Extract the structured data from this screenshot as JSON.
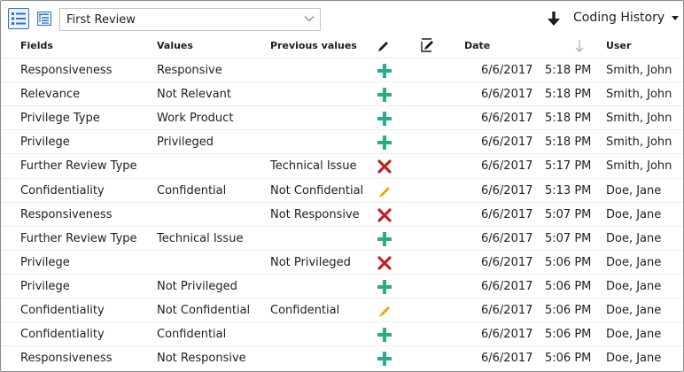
{
  "toolbar": {
    "dropdown_value": "First Review",
    "history_title": "Coding History"
  },
  "columns": {
    "fields": "Fields",
    "values": "Values",
    "previous": "Previous values",
    "date": "Date",
    "user": "User"
  },
  "colors": {
    "accent": "#2f72c4",
    "added": "#2bab8d",
    "removed": "#c42127",
    "edited": "#f5a00a"
  },
  "rows": [
    {
      "field": "Responsiveness",
      "value": "Responsive",
      "previous": "",
      "action": "add-icon",
      "date": "6/6/2017",
      "time": "5:18 PM",
      "user": "Smith, John"
    },
    {
      "field": "Relevance",
      "value": "Not Relevant",
      "previous": "",
      "action": "add-icon",
      "date": "6/6/2017",
      "time": "5:18 PM",
      "user": "Smith, John"
    },
    {
      "field": "Privilege Type",
      "value": "Work Product",
      "previous": "",
      "action": "add-icon",
      "date": "6/6/2017",
      "time": "5:18 PM",
      "user": "Smith, John"
    },
    {
      "field": "Privilege",
      "value": "Privileged",
      "previous": "",
      "action": "add-icon",
      "date": "6/6/2017",
      "time": "5:18 PM",
      "user": "Smith, John"
    },
    {
      "field": "Further Review Type",
      "value": "",
      "previous": "Technical Issue",
      "action": "remove-icon",
      "date": "6/6/2017",
      "time": "5:17 PM",
      "user": "Smith, John"
    },
    {
      "field": "Confidentiality",
      "value": "Confidential",
      "previous": "Not Confidential",
      "action": "edit-icon",
      "date": "6/6/2017",
      "time": "5:13 PM",
      "user": "Doe, Jane"
    },
    {
      "field": "Responsiveness",
      "value": "",
      "previous": "Not Responsive",
      "action": "remove-icon",
      "date": "6/6/2017",
      "time": "5:07 PM",
      "user": "Doe, Jane"
    },
    {
      "field": "Further Review Type",
      "value": "Technical Issue",
      "previous": "",
      "action": "add-icon",
      "date": "6/6/2017",
      "time": "5:07 PM",
      "user": "Doe, Jane"
    },
    {
      "field": "Privilege",
      "value": "",
      "previous": "Not Privileged",
      "action": "remove-icon",
      "date": "6/6/2017",
      "time": "5:06 PM",
      "user": "Doe, Jane"
    },
    {
      "field": "Privilege",
      "value": "Not Privileged",
      "previous": "",
      "action": "add-icon",
      "date": "6/6/2017",
      "time": "5:06 PM",
      "user": "Doe, Jane"
    },
    {
      "field": "Confidentiality",
      "value": "Not Confidential",
      "previous": "Confidential",
      "action": "edit-icon",
      "date": "6/6/2017",
      "time": "5:06 PM",
      "user": "Doe, Jane"
    },
    {
      "field": "Confidentiality",
      "value": "Confidential",
      "previous": "",
      "action": "add-icon",
      "date": "6/6/2017",
      "time": "5:06 PM",
      "user": "Doe, Jane"
    },
    {
      "field": "Responsiveness",
      "value": "Not Responsive",
      "previous": "",
      "action": "add-icon",
      "date": "6/6/2017",
      "time": "5:06 PM",
      "user": "Doe, Jane"
    }
  ]
}
